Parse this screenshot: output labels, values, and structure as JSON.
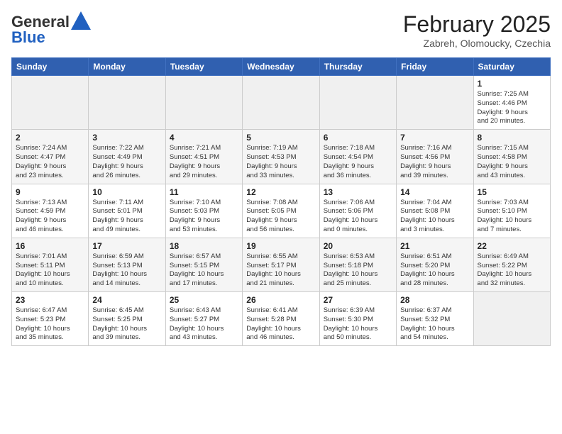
{
  "header": {
    "logo_line1": "General",
    "logo_line2": "Blue",
    "month_year": "February 2025",
    "location": "Zabreh, Olomoucky, Czechia"
  },
  "days_of_week": [
    "Sunday",
    "Monday",
    "Tuesday",
    "Wednesday",
    "Thursday",
    "Friday",
    "Saturday"
  ],
  "weeks": [
    [
      {
        "day": "",
        "info": ""
      },
      {
        "day": "",
        "info": ""
      },
      {
        "day": "",
        "info": ""
      },
      {
        "day": "",
        "info": ""
      },
      {
        "day": "",
        "info": ""
      },
      {
        "day": "",
        "info": ""
      },
      {
        "day": "1",
        "info": "Sunrise: 7:25 AM\nSunset: 4:46 PM\nDaylight: 9 hours\nand 20 minutes."
      }
    ],
    [
      {
        "day": "2",
        "info": "Sunrise: 7:24 AM\nSunset: 4:47 PM\nDaylight: 9 hours\nand 23 minutes."
      },
      {
        "day": "3",
        "info": "Sunrise: 7:22 AM\nSunset: 4:49 PM\nDaylight: 9 hours\nand 26 minutes."
      },
      {
        "day": "4",
        "info": "Sunrise: 7:21 AM\nSunset: 4:51 PM\nDaylight: 9 hours\nand 29 minutes."
      },
      {
        "day": "5",
        "info": "Sunrise: 7:19 AM\nSunset: 4:53 PM\nDaylight: 9 hours\nand 33 minutes."
      },
      {
        "day": "6",
        "info": "Sunrise: 7:18 AM\nSunset: 4:54 PM\nDaylight: 9 hours\nand 36 minutes."
      },
      {
        "day": "7",
        "info": "Sunrise: 7:16 AM\nSunset: 4:56 PM\nDaylight: 9 hours\nand 39 minutes."
      },
      {
        "day": "8",
        "info": "Sunrise: 7:15 AM\nSunset: 4:58 PM\nDaylight: 9 hours\nand 43 minutes."
      }
    ],
    [
      {
        "day": "9",
        "info": "Sunrise: 7:13 AM\nSunset: 4:59 PM\nDaylight: 9 hours\nand 46 minutes."
      },
      {
        "day": "10",
        "info": "Sunrise: 7:11 AM\nSunset: 5:01 PM\nDaylight: 9 hours\nand 49 minutes."
      },
      {
        "day": "11",
        "info": "Sunrise: 7:10 AM\nSunset: 5:03 PM\nDaylight: 9 hours\nand 53 minutes."
      },
      {
        "day": "12",
        "info": "Sunrise: 7:08 AM\nSunset: 5:05 PM\nDaylight: 9 hours\nand 56 minutes."
      },
      {
        "day": "13",
        "info": "Sunrise: 7:06 AM\nSunset: 5:06 PM\nDaylight: 10 hours\nand 0 minutes."
      },
      {
        "day": "14",
        "info": "Sunrise: 7:04 AM\nSunset: 5:08 PM\nDaylight: 10 hours\nand 3 minutes."
      },
      {
        "day": "15",
        "info": "Sunrise: 7:03 AM\nSunset: 5:10 PM\nDaylight: 10 hours\nand 7 minutes."
      }
    ],
    [
      {
        "day": "16",
        "info": "Sunrise: 7:01 AM\nSunset: 5:11 PM\nDaylight: 10 hours\nand 10 minutes."
      },
      {
        "day": "17",
        "info": "Sunrise: 6:59 AM\nSunset: 5:13 PM\nDaylight: 10 hours\nand 14 minutes."
      },
      {
        "day": "18",
        "info": "Sunrise: 6:57 AM\nSunset: 5:15 PM\nDaylight: 10 hours\nand 17 minutes."
      },
      {
        "day": "19",
        "info": "Sunrise: 6:55 AM\nSunset: 5:17 PM\nDaylight: 10 hours\nand 21 minutes."
      },
      {
        "day": "20",
        "info": "Sunrise: 6:53 AM\nSunset: 5:18 PM\nDaylight: 10 hours\nand 25 minutes."
      },
      {
        "day": "21",
        "info": "Sunrise: 6:51 AM\nSunset: 5:20 PM\nDaylight: 10 hours\nand 28 minutes."
      },
      {
        "day": "22",
        "info": "Sunrise: 6:49 AM\nSunset: 5:22 PM\nDaylight: 10 hours\nand 32 minutes."
      }
    ],
    [
      {
        "day": "23",
        "info": "Sunrise: 6:47 AM\nSunset: 5:23 PM\nDaylight: 10 hours\nand 35 minutes."
      },
      {
        "day": "24",
        "info": "Sunrise: 6:45 AM\nSunset: 5:25 PM\nDaylight: 10 hours\nand 39 minutes."
      },
      {
        "day": "25",
        "info": "Sunrise: 6:43 AM\nSunset: 5:27 PM\nDaylight: 10 hours\nand 43 minutes."
      },
      {
        "day": "26",
        "info": "Sunrise: 6:41 AM\nSunset: 5:28 PM\nDaylight: 10 hours\nand 46 minutes."
      },
      {
        "day": "27",
        "info": "Sunrise: 6:39 AM\nSunset: 5:30 PM\nDaylight: 10 hours\nand 50 minutes."
      },
      {
        "day": "28",
        "info": "Sunrise: 6:37 AM\nSunset: 5:32 PM\nDaylight: 10 hours\nand 54 minutes."
      },
      {
        "day": "",
        "info": ""
      }
    ]
  ]
}
